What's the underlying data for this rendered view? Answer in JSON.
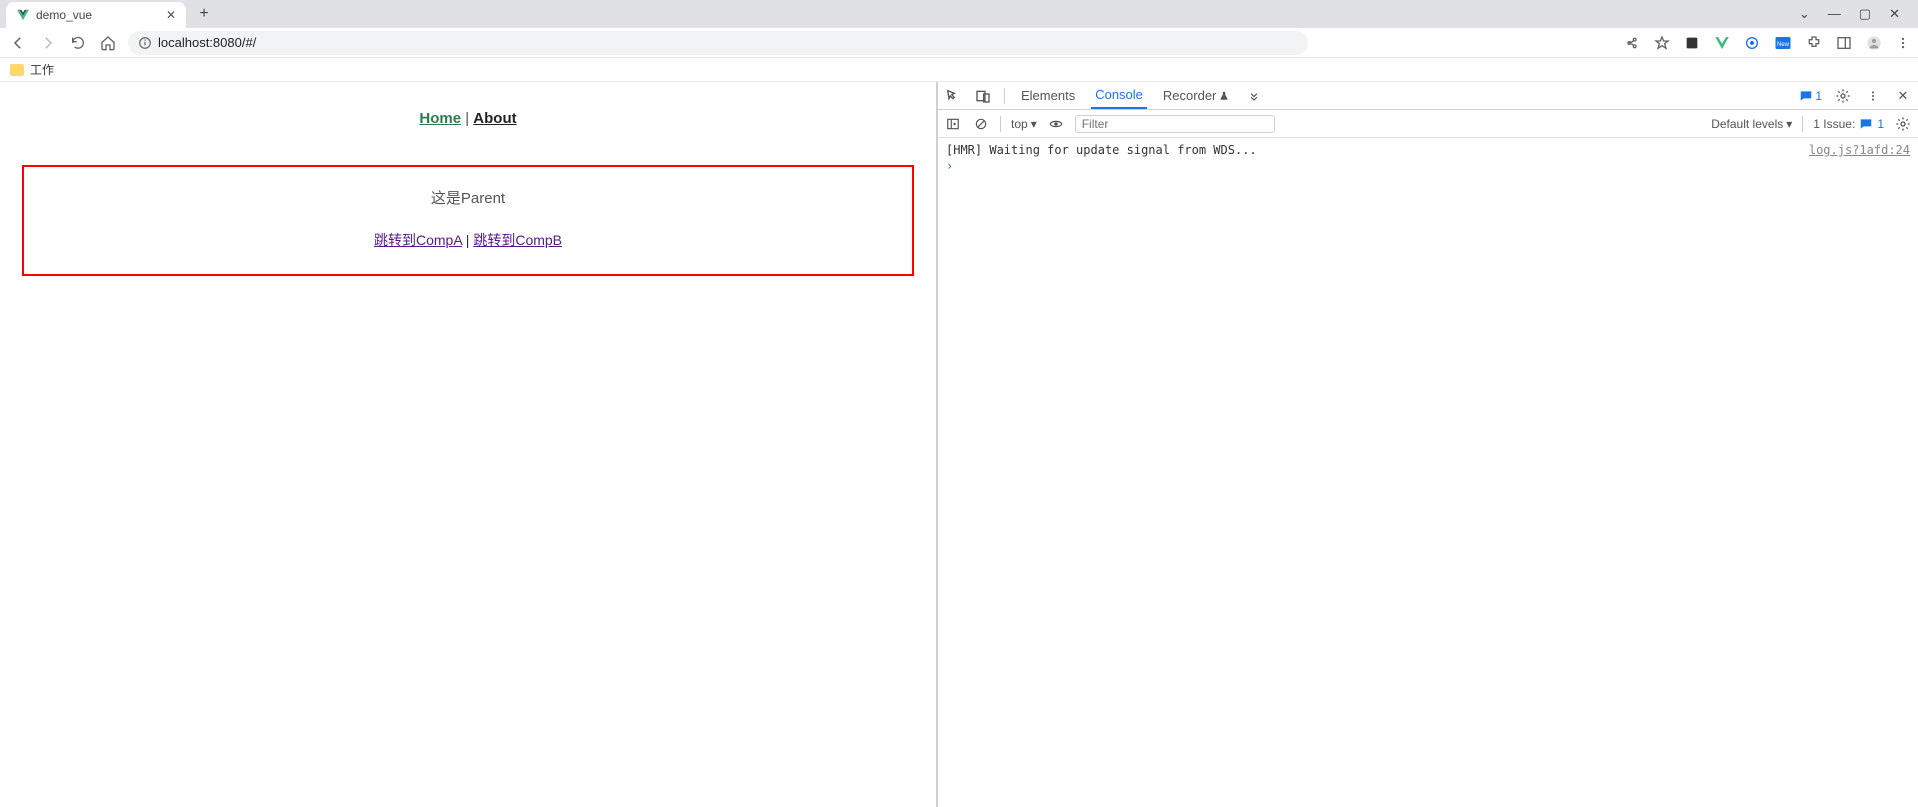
{
  "browser": {
    "tab_title": "demo_vue",
    "url_display": "localhost:8080/#/",
    "bookmark_folder": "工作"
  },
  "page": {
    "nav": {
      "home": "Home",
      "about": "About",
      "sep": " | "
    },
    "parent": {
      "heading": "这是Parent",
      "link_a": "跳转到CompA",
      "link_b": "跳转到CompB",
      "sep": " | "
    }
  },
  "devtools": {
    "tabs": {
      "elements": "Elements",
      "console": "Console",
      "recorder": "Recorder"
    },
    "msg_count": "1",
    "toolbar": {
      "context": "top",
      "filter_placeholder": "Filter",
      "levels": "Default levels",
      "issues_label": "1 Issue:",
      "issues_count": "1"
    },
    "console_line": "[HMR] Waiting for update signal from WDS...",
    "console_src": "log.js?1afd:24"
  }
}
